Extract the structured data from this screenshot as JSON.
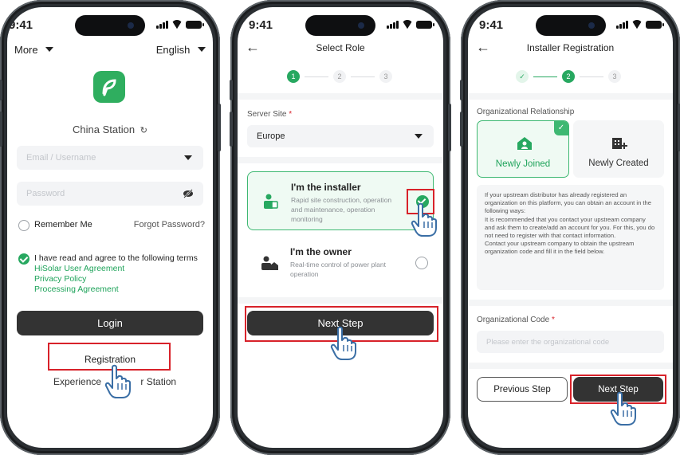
{
  "status_bar": {
    "time": "9:41"
  },
  "login_screen": {
    "more_label": "More",
    "language_label": "English",
    "station_name": "China Station",
    "email_placeholder": "Email / Username",
    "password_placeholder": "Password",
    "remember_me": "Remember Me",
    "forgot_password": "Forgot Password?",
    "agree_text": "I have read and agree to the following terms",
    "terms": [
      "HiSolar User Agreement",
      "Privacy Policy",
      "Processing Agreement"
    ],
    "login_button": "Login",
    "registration_link": "Registration",
    "experience_prefix": "Experience",
    "experience_suffix": "r Station"
  },
  "role_screen": {
    "title": "Select Role",
    "steps": [
      "1",
      "2",
      "3"
    ],
    "server_site_label": "Server Site",
    "required_mark": "*",
    "server_site_value": "Europe",
    "roles": [
      {
        "title": "I'm the installer",
        "description": "Rapid site construction, operation and maintenance, operation monitoring",
        "selected": true
      },
      {
        "title": "I'm the owner",
        "description": "Real-time control of power plant operation",
        "selected": false
      }
    ],
    "next_button": "Next Step"
  },
  "installer_screen": {
    "title": "Installer Registration",
    "steps": [
      "1",
      "2",
      "3"
    ],
    "org_relationship_label": "Organizational Relationship",
    "options": [
      {
        "label": "Newly Joined",
        "selected": true
      },
      {
        "label": "Newly Created",
        "selected": false
      }
    ],
    "info_text": "If your upstream distributor has already registered an organization on this platform, you can obtain an account in the following ways:\nIt is recommended that you contact your upstream company and ask them to create/add an account for you. For this, you do not need to register with that contact information.\nContact your upstream company to obtain the upstream organization code and fill it in the field below.",
    "org_code_label": "Organizational Code",
    "required_mark": "*",
    "org_code_placeholder": "Please enter the organizational code",
    "previous_button": "Previous Step",
    "next_button": "Next Step"
  },
  "colors": {
    "accent": "#1ea35a",
    "highlight": "#d8222a",
    "dark_button": "#333333",
    "tap_hand": "#3a6ea5"
  }
}
